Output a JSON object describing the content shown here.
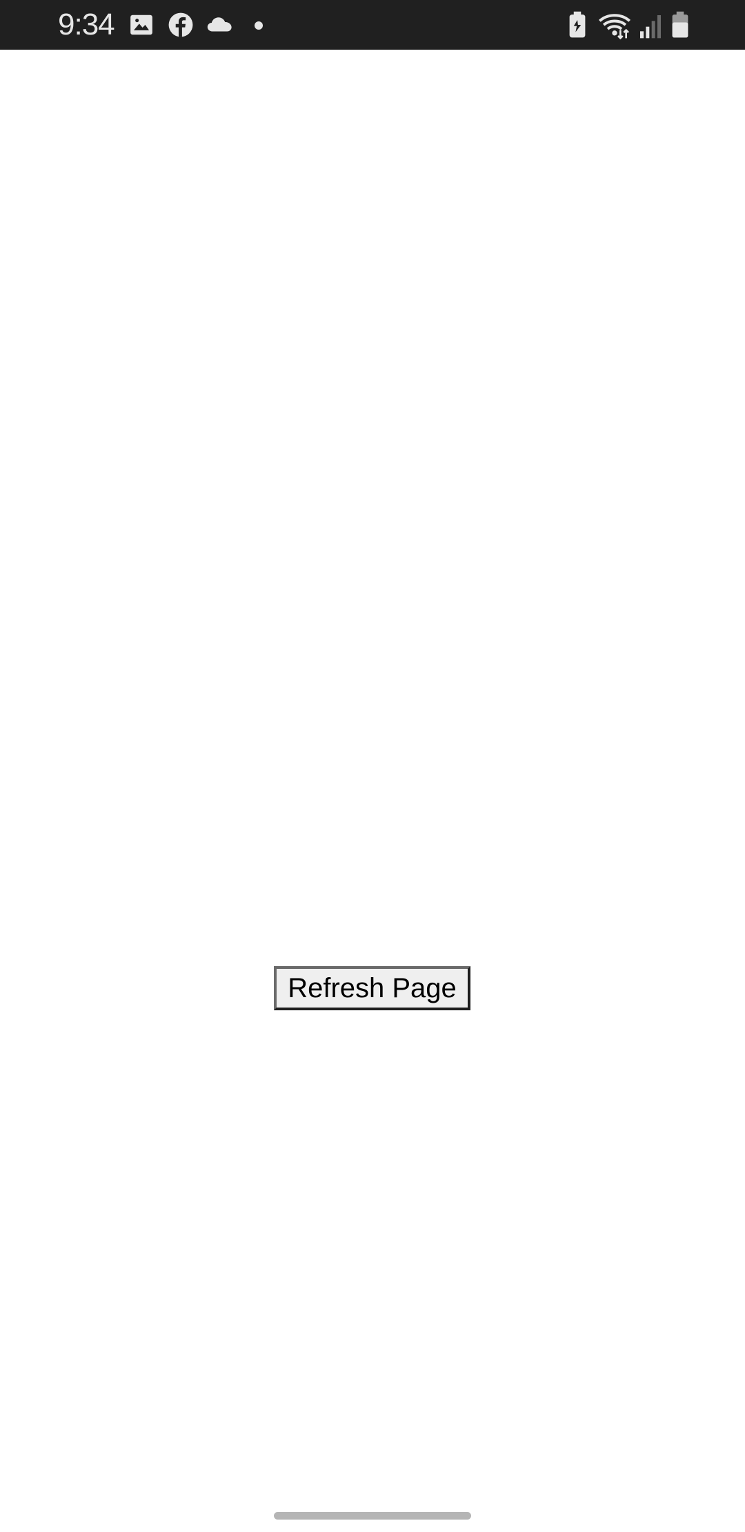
{
  "status_bar": {
    "time": "9:34",
    "left_icons": [
      "image-icon",
      "facebook-icon",
      "cloud-icon",
      "dot-icon"
    ],
    "right_icons": [
      "battery-saver-icon",
      "wifi-icon",
      "signal-icon",
      "battery-icon"
    ],
    "background_color": "#202020",
    "icon_color": "#e6e6e6"
  },
  "main": {
    "refresh_button_label": "Refresh Page"
  },
  "colors": {
    "page_background": "#ffffff",
    "button_background": "#efefef",
    "nav_handle": "#b5b5b5"
  }
}
